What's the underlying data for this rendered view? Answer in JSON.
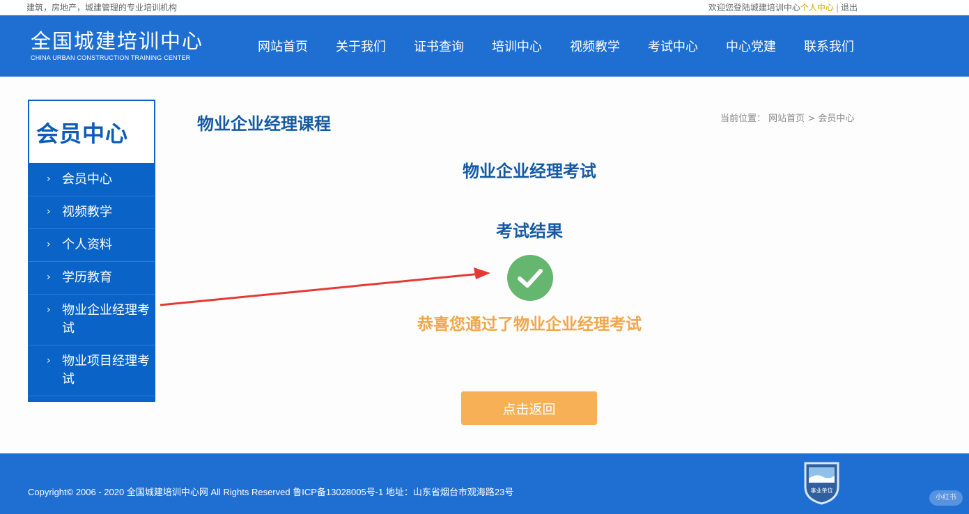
{
  "topbar": {
    "tagline": "建筑，房地产，城建管理的专业培训机构",
    "welcome": "欢迎您登陆城建培训中心",
    "member_link": "个人中心",
    "separator": "|",
    "logout": "退出"
  },
  "header": {
    "logo_cn": "全国城建培训中心",
    "logo_en": "CHINA URBAN CONSTRUCTION TRAINING CENTER",
    "nav": [
      {
        "label": "网站首页"
      },
      {
        "label": "关于我们"
      },
      {
        "label": "证书查询"
      },
      {
        "label": "培训中心"
      },
      {
        "label": "视频教学"
      },
      {
        "label": "考试中心"
      },
      {
        "label": "中心党建"
      },
      {
        "label": "联系我们"
      }
    ]
  },
  "sidebar": {
    "title": "会员中心",
    "chevron": "›",
    "items": [
      {
        "label": "会员中心"
      },
      {
        "label": "视频教学"
      },
      {
        "label": "个人资料"
      },
      {
        "label": "学历教育"
      },
      {
        "label": "物业企业经理考试"
      },
      {
        "label": "物业项目经理考试"
      }
    ]
  },
  "main": {
    "course_title": "物业企业经理课程",
    "breadcrumb": {
      "prefix": "当前位置：",
      "home": "网站首页",
      "sep": ">",
      "current": "会员中心"
    },
    "exam_title": "物业企业经理考试",
    "result_title": "考试结果",
    "congrats": "恭喜您通过了物业企业经理考试",
    "back_button": "点击返回"
  },
  "footer": {
    "copyright": "Copyright© 2006 - 2020 全国城建培训中心网 All Rights Reserved 鲁ICP备13028005号-1 地址：山东省烟台市观海路23号",
    "badge_text": "事业单位",
    "watermark": "小红书"
  },
  "colors": {
    "header_blue": "#1f6fd3",
    "sidebar_blue": "#0a64c8",
    "title_blue": "#155aa3",
    "success_green": "#65b66f",
    "accent_orange": "#f2a64a",
    "button_orange": "#f7b055",
    "arrow_red": "#e53935"
  }
}
